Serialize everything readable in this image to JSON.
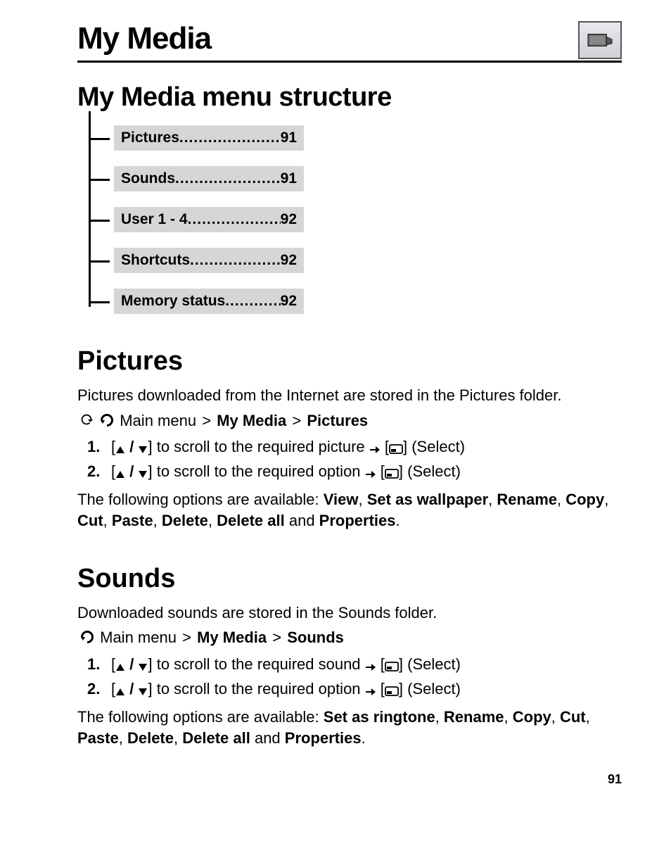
{
  "header": {
    "title": "My Media"
  },
  "section1": {
    "heading": "My Media menu structure",
    "items": [
      {
        "label": "Pictures",
        "page": "91"
      },
      {
        "label": "Sounds",
        "page": "91"
      },
      {
        "label": "User 1 - 4",
        "page": "92"
      },
      {
        "label": "Shortcuts",
        "page": "92"
      },
      {
        "label": "Memory status",
        "page": "92"
      }
    ]
  },
  "pictures": {
    "heading": "Pictures",
    "intro": "Pictures downloaded from the Internet are stored in the Pictures folder.",
    "nav_prefix": "Main menu",
    "nav_sep": ">",
    "nav_mid": "My Media",
    "nav_last": "Pictures",
    "step1_a": "to scroll to the required picture",
    "step1_b": "(Select)",
    "step2_a": "to scroll to the required option",
    "step2_b": "(Select)",
    "opts_lead": "The following options are available: ",
    "opts": [
      "View",
      "Set as wallpaper",
      "Rename",
      "Copy",
      "Cut",
      "Paste",
      "Delete",
      "Delete all"
    ],
    "opts_and": " and ",
    "opts_last": "Properties",
    "period": "."
  },
  "sounds": {
    "heading": "Sounds",
    "intro": "Downloaded sounds are stored in the Sounds folder.",
    "nav_prefix": "Main menu",
    "nav_sep": ">",
    "nav_mid": "My Media",
    "nav_last": "Sounds",
    "step1_a": "to scroll to the required sound",
    "step1_b": "(Select)",
    "step2_a": "to scroll to the required option",
    "step2_b": "(Select)",
    "opts_lead": "The following options are available: ",
    "opts": [
      "Set as ringtone",
      "Rename",
      "Copy",
      "Cut",
      "Paste",
      "Delete",
      "Delete all"
    ],
    "opts_and": " and ",
    "opts_last": "Properties",
    "period": "."
  },
  "glyphs": {
    "num1": "1.",
    "num2": "2.",
    "comma": ", "
  },
  "footer": {
    "page": "91"
  }
}
